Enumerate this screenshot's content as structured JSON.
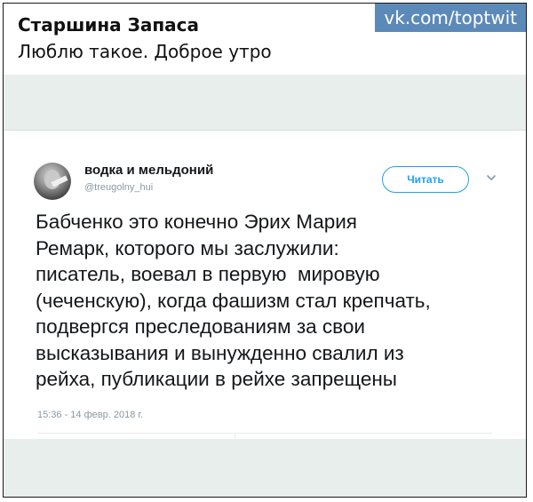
{
  "post": {
    "author": "Старшина Запаса",
    "text": "Люблю такое. Доброе утро",
    "watermark": "vk.com/toptwit"
  },
  "tweet": {
    "display_name": "водка и мельдоний",
    "handle": "@treugolny_hui",
    "follow_label": "Читать",
    "body_lines": [
      "Бабченко это конечно Эрих Мария",
      "Ремарк, которого мы заслужили:",
      "писатель, воевал в первую  мировую",
      "(чеченскую), когда фашизм стал крепчать,",
      "подвергся преследованиям за свои",
      "высказывания и вынужденно свалил из",
      "рейха, публикации в рейхе запрещены"
    ],
    "timestamp": "15:36 - 14 февр. 2018 г.",
    "accent_color": "#1da1f2"
  },
  "icons": {
    "menu": "chevron-down-icon",
    "avatar": "user-avatar"
  }
}
